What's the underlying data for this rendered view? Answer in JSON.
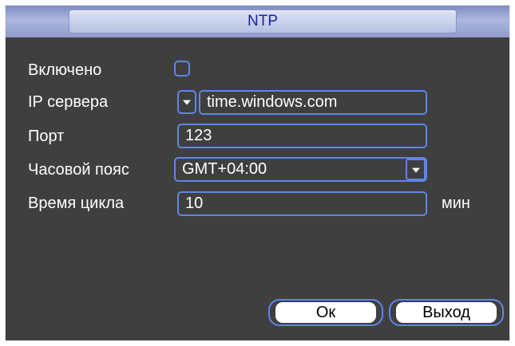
{
  "dialog": {
    "title": "NTP"
  },
  "form": {
    "enabled": {
      "label": "Включено",
      "checked": false
    },
    "server_ip": {
      "label": "IP сервера",
      "value": "time.windows.com"
    },
    "port": {
      "label": "Порт",
      "value": "123"
    },
    "timezone": {
      "label": "Часовой пояс",
      "value": "GMT+04:00"
    },
    "cycle_time": {
      "label": "Время цикла",
      "value": "10",
      "unit": "мин"
    }
  },
  "buttons": {
    "ok": "Ок",
    "exit": "Выход"
  },
  "colors": {
    "background": "#3f3f3f",
    "control_border": "#5f86e8",
    "title_text": "#1a22a0"
  }
}
